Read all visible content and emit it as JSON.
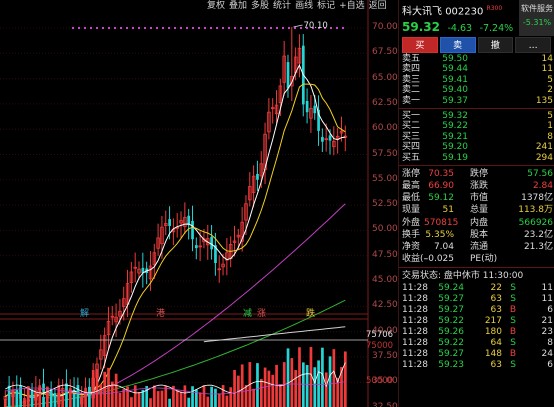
{
  "toolbar": [
    "复权",
    "叠加",
    "多股",
    "统计",
    "画线",
    "标记",
    "+自选",
    "返回"
  ],
  "chart": {
    "price_ticks": [
      "70.00",
      "67.50",
      "65.00",
      "62.50",
      "60.00",
      "57.50",
      "55.00",
      "52.50",
      "50.00",
      "47.50",
      "45.00",
      "42.50",
      "40.00",
      "37.50",
      "35.00",
      "32.50"
    ],
    "high_label": "70.10",
    "markers": [
      {
        "text": "解",
        "color": "#2fa8d0"
      },
      {
        "text": "港",
        "color": "#e05050"
      },
      {
        "text": "减",
        "color": "#2ad048"
      },
      {
        "text": "涨",
        "color": "#e05050"
      },
      {
        "text": "跌",
        "color": "#e8d040"
      }
    ],
    "volume_ticks": [
      "75706",
      "75000",
      "50000"
    ],
    "colors": {
      "up": "#f03a3a",
      "down": "#25d4d4",
      "ma5": "#ffffff",
      "ma10": "#f0d020",
      "ma20": "#c040c0",
      "ma60": "#30b030",
      "ma120": "#d0d0d0"
    }
  },
  "stock": {
    "name": "科大讯飞",
    "code": "002230",
    "index_tag": "R",
    "index_num": "300",
    "price": "59.32",
    "change": "-4.63",
    "change_pct": "-7.24%"
  },
  "sector": {
    "name": "软件服务",
    "change": "-5.31%"
  },
  "buttons": {
    "buy": "买",
    "sell": "卖",
    "cancel": "撤",
    "more": "…"
  },
  "asks": [
    {
      "label": "卖五",
      "price": "59.50",
      "qty": "14"
    },
    {
      "label": "卖四",
      "price": "59.44",
      "qty": "11"
    },
    {
      "label": "卖三",
      "price": "59.41",
      "qty": "5"
    },
    {
      "label": "卖二",
      "price": "59.40",
      "qty": "2"
    },
    {
      "label": "卖一",
      "price": "59.37",
      "qty": "135"
    }
  ],
  "bids": [
    {
      "label": "买一",
      "price": "59.32",
      "qty": "5"
    },
    {
      "label": "买二",
      "price": "59.22",
      "qty": "1"
    },
    {
      "label": "买三",
      "price": "59.21",
      "qty": "8"
    },
    {
      "label": "买四",
      "price": "59.20",
      "qty": "241"
    },
    {
      "label": "买五",
      "price": "59.19",
      "qty": "294"
    }
  ],
  "stats": [
    {
      "k": "涨停",
      "v": "70.35",
      "vc": "red",
      "k2": "跌停",
      "v2": "57.56",
      "v2c": "green"
    },
    {
      "k": "最高",
      "v": "66.90",
      "vc": "red",
      "k2": "涨跌",
      "v2": "2.84",
      "v2c": "red"
    },
    {
      "k": "最低",
      "v": "59.12",
      "vc": "green",
      "k2": "市值",
      "v2": "1378亿",
      "v2c": "white"
    },
    {
      "k": "现量",
      "v": "51",
      "vc": "yellow",
      "k2": "总量",
      "v2": "113.8万",
      "v2c": "yellow"
    },
    {
      "k": "外盘",
      "v": "570815",
      "vc": "red",
      "k2": "内盘",
      "v2": "566926",
      "v2c": "green"
    },
    {
      "k": "换手",
      "v": "5.35%",
      "vc": "yellow",
      "k2": "股本",
      "v2": "23.2亿",
      "v2c": "white"
    },
    {
      "k": "净资",
      "v": "7.04",
      "vc": "white",
      "k2": "流通",
      "v2": "21.3亿",
      "v2c": "white"
    },
    {
      "k": "收益(-",
      "v": "-0.025",
      "vc": "white",
      "k2": "PE(动)",
      "v2": "",
      "v2c": "white"
    }
  ],
  "ticks_title": "交易状态: 盘中休市 11:30:00",
  "ticks": [
    {
      "t": "11:28",
      "p": "59.24",
      "v": "22",
      "d": "S",
      "dc": "green",
      "n": "11"
    },
    {
      "t": "11:28",
      "p": "59.27",
      "v": "63",
      "d": "S",
      "dc": "green",
      "n": "11"
    },
    {
      "t": "11:28",
      "p": "59.27",
      "v": "63",
      "d": "B",
      "dc": "red",
      "n": "6"
    },
    {
      "t": "11:28",
      "p": "59.22",
      "v": "217",
      "d": "S",
      "dc": "green",
      "n": "21"
    },
    {
      "t": "11:28",
      "p": "59.26",
      "v": "180",
      "d": "B",
      "dc": "red",
      "n": "23"
    },
    {
      "t": "11:28",
      "p": "59.22",
      "v": "64",
      "d": "S",
      "dc": "green",
      "n": "8"
    },
    {
      "t": "11:28",
      "p": "59.27",
      "v": "148",
      "d": "B",
      "dc": "red",
      "n": "24"
    },
    {
      "t": "11:28",
      "p": "59.23",
      "v": "63",
      "d": "S",
      "dc": "green",
      "n": "6"
    }
  ]
}
